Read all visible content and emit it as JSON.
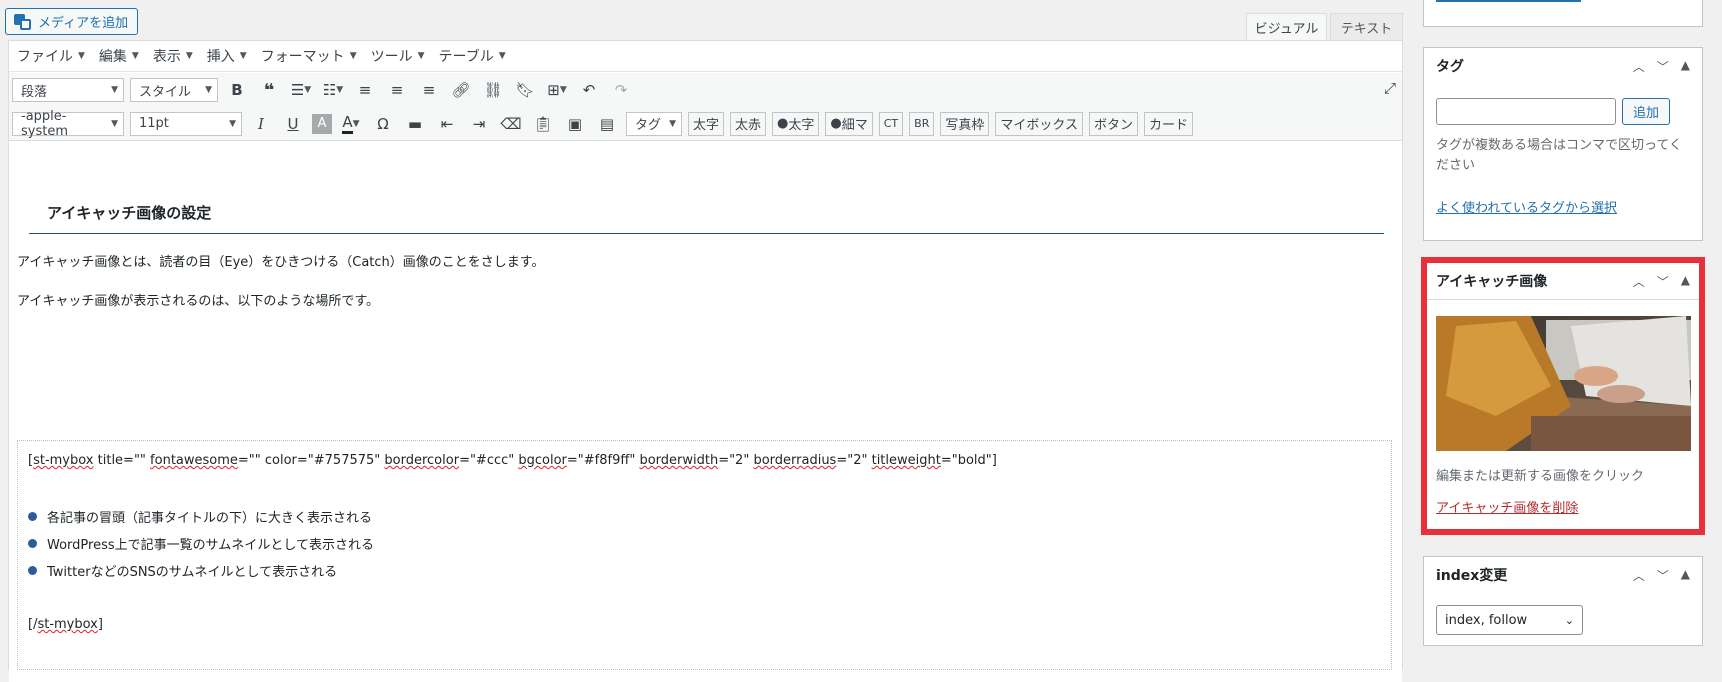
{
  "editor": {
    "media_button": "メディアを追加",
    "tabs": {
      "visual": "ビジュアル",
      "text": "テキスト"
    },
    "menus": [
      "ファイル",
      "編集",
      "表示",
      "挿入",
      "フォーマット",
      "ツール",
      "テーブル"
    ],
    "toolbar1": {
      "format_select": "段落",
      "style_select": "スタイル"
    },
    "toolbar2": {
      "font_select": "-apple-system",
      "size_select": "11pt",
      "tag_select": "タグ",
      "buttons": [
        "太字",
        "太赤",
        "太字",
        "細マ",
        "CT",
        "BR",
        "写真枠",
        "マイボックス",
        "ボタン",
        "カード"
      ]
    },
    "content": {
      "heading": "アイキャッチ画像の設定",
      "para1": "アイキャッチ画像とは、読者の目（Eye）をひきつける（Catch）画像のことをさします。",
      "para2": "アイキャッチ画像が表示されるのは、以下のような場所です。",
      "shortcode_open": {
        "p1": "[",
        "p2": "st-mybox",
        "p3": " title=\"\" ",
        "p4": "fontawesome",
        "p5": "=\"\" color=\"#757575\" ",
        "p6": "bordercolor",
        "p7": "=\"#ccc\" ",
        "p8": "bgcolor",
        "p9": "=\"#f8f9ff\" ",
        "p10": "borderwidth",
        "p11": "=\"2\" ",
        "p12": "borderradius",
        "p13": "=\"2\" ",
        "p14": "titleweight",
        "p15": "=\"bold\"]"
      },
      "bullets": [
        "各記事の冒頭（記事タイトルの下）に大きく表示される",
        "WordPress上で記事一覧のサムネイルとして表示される",
        "TwitterなどのSNSのサムネイルとして表示される"
      ],
      "shortcode_close": {
        "p1": "[/",
        "p2": "st-mybox",
        "p3": "]"
      }
    }
  },
  "sidebar": {
    "tags": {
      "title": "タグ",
      "add_button": "追加",
      "description": "タグが複数ある場合はコンマで区切ってください",
      "link": "よく使われているタグから選択"
    },
    "eyecatch": {
      "title": "アイキャッチ画像",
      "caption": "編集または更新する画像をクリック",
      "remove_link": "アイキャッチ画像を削除"
    },
    "index": {
      "title": "index変更",
      "selected": "index, follow"
    }
  },
  "colors": {
    "accent": "#2271b1",
    "highlight": "#e8303a",
    "bullet": "#2d5a9e"
  }
}
